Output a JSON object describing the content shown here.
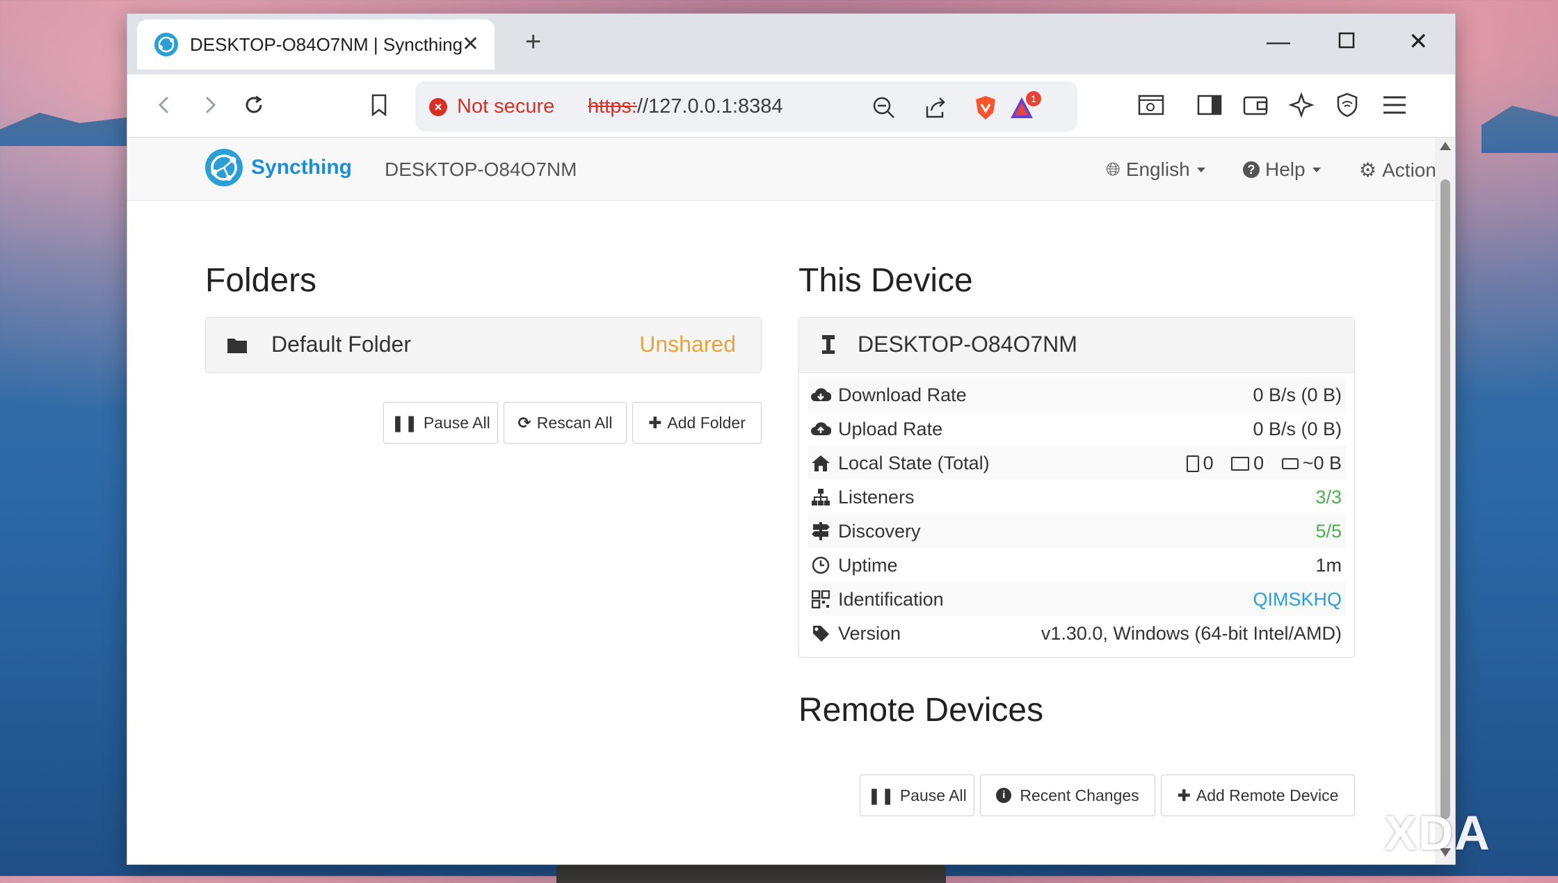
{
  "browser": {
    "tab_title": "DESKTOP-O84O7NM | Syncthing",
    "security_label": "Not secure",
    "url_scheme": "https:",
    "url_rest": "//127.0.0.1:8384",
    "notification_count": "1"
  },
  "app": {
    "brand": "Syncthing",
    "device_name": "DESKTOP-O84O7NM",
    "menus": {
      "language": "English",
      "help": "Help",
      "actions": "Actions"
    }
  },
  "folders": {
    "title": "Folders",
    "items": [
      {
        "name": "Default Folder",
        "status": "Unshared"
      }
    ],
    "buttons": {
      "pause_all": "Pause All",
      "rescan_all": "Rescan All",
      "add_folder": "Add Folder"
    }
  },
  "this_device": {
    "title": "This Device",
    "name": "DESKTOP-O84O7NM",
    "download_label": "Download Rate",
    "download_value": "0 B/s (0 B)",
    "upload_label": "Upload Rate",
    "upload_value": "0 B/s (0 B)",
    "local_state_label": "Local State (Total)",
    "local_files": "0",
    "local_dirs": "0",
    "local_size": "~0 B",
    "listeners_label": "Listeners",
    "listeners_value": "3/3",
    "discovery_label": "Discovery",
    "discovery_value": "5/5",
    "uptime_label": "Uptime",
    "uptime_value": "1m",
    "identification_label": "Identification",
    "identification_value": "QIMSKHQ",
    "version_label": "Version",
    "version_value": "v1.30.0, Windows (64-bit Intel/AMD)"
  },
  "remote_devices": {
    "title": "Remote Devices",
    "buttons": {
      "pause_all": "Pause All",
      "recent_changes": "Recent Changes",
      "add_remote": "Add Remote Device"
    }
  },
  "watermark": "XDA",
  "colors": {
    "accent": "#2a9fd6",
    "warning": "#e8a33a",
    "success": "#4cae4c",
    "danger": "#d93025"
  }
}
